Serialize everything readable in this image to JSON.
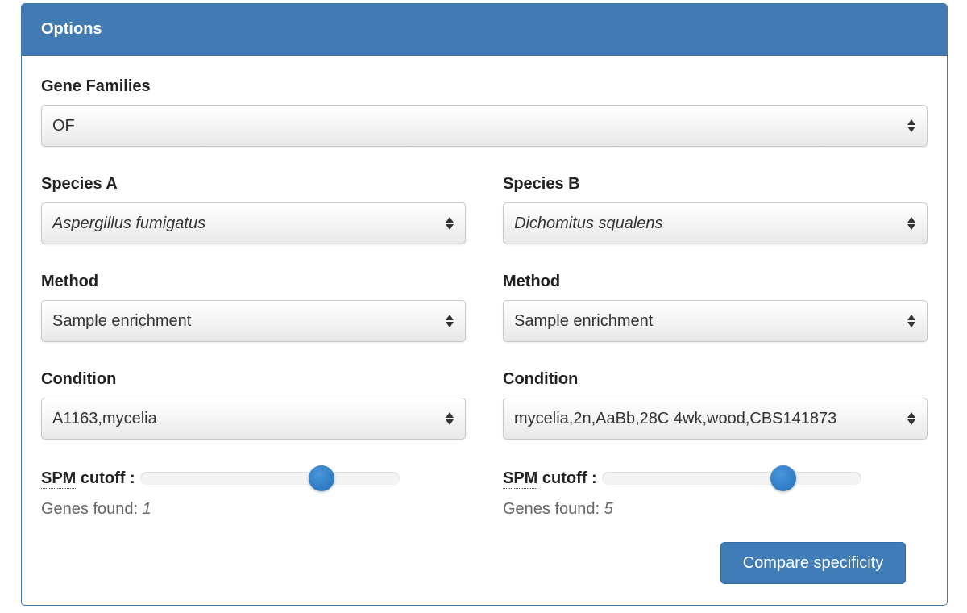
{
  "panel": {
    "title": "Options"
  },
  "gene_families": {
    "label": "Gene Families",
    "value": "OF"
  },
  "species_a": {
    "label": "Species A",
    "value": "Aspergillus fumigatus",
    "method_label": "Method",
    "method_value": "Sample enrichment",
    "condition_label": "Condition",
    "condition_value": "A1163,mycelia",
    "spm_abbr": "SPM",
    "spm_rest": " cutoff :",
    "spm_level": 0.7,
    "genes_found_label": "Genes found:",
    "genes_found_count": "1"
  },
  "species_b": {
    "label": "Species B",
    "value": "Dichomitus squalens",
    "method_label": "Method",
    "method_value": "Sample enrichment",
    "condition_label": "Condition",
    "condition_value": "mycelia,2n,AaBb,28C 4wk,wood,CBS141873",
    "spm_abbr": "SPM",
    "spm_rest": " cutoff :",
    "spm_level": 0.7,
    "genes_found_label": "Genes found:",
    "genes_found_count": "5"
  },
  "actions": {
    "compare_label": "Compare specificity"
  },
  "colors": {
    "heading_bg": "#427bb4",
    "slider_handle": "#2e7bc4",
    "button_bg": "#3f7cb8"
  },
  "icons": {
    "select_caret": "up-down-caret-icon"
  }
}
